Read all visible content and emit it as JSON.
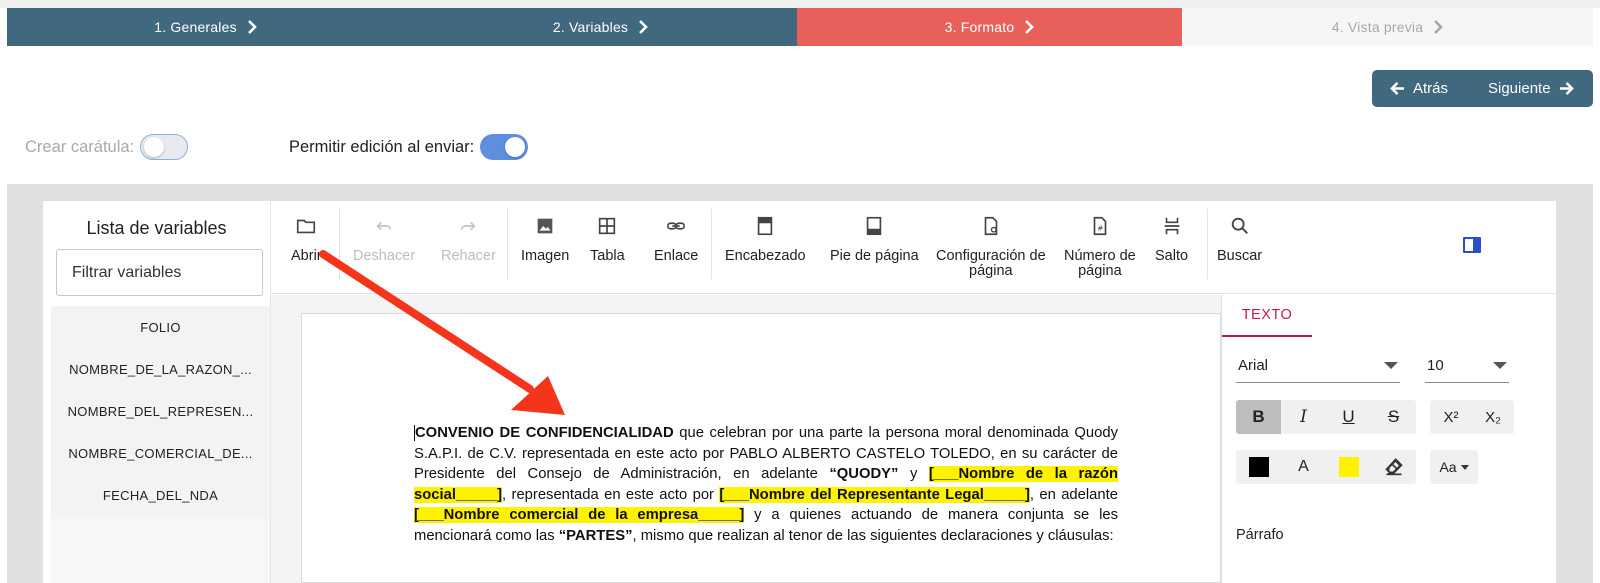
{
  "stepper": {
    "steps": [
      {
        "label": "1. Generales"
      },
      {
        "label": "2. Variables"
      },
      {
        "label": "3. Formato"
      },
      {
        "label": "4. Vista previa"
      }
    ]
  },
  "nav": {
    "back_label": "Atrás",
    "next_label": "Siguiente"
  },
  "toggles": {
    "cover_label": "Crear carátula:",
    "cover_on": false,
    "edit_label": "Permitir edición al enviar:",
    "edit_on": true
  },
  "variables": {
    "title": "Lista de variables",
    "filter_placeholder": "Filtrar variables",
    "items": [
      "FOLIO",
      "NOMBRE_DE_LA_RAZON_...",
      "NOMBRE_DEL_REPRESEN...",
      "NOMBRE_COMERCIAL_DE...",
      "FECHA_DEL_NDA"
    ]
  },
  "toolbar": {
    "open": "Abrir",
    "undo": "Deshacer",
    "redo": "Rehacer",
    "image": "Imagen",
    "table": "Tabla",
    "link": "Enlace",
    "header": "Encabezado",
    "footer": "Pie de página",
    "page_setup_1": "Configuración de",
    "page_setup_2": "página",
    "page_number_1": "Número de",
    "page_number_2": "página",
    "break": "Salto",
    "search": "Buscar"
  },
  "document": {
    "title": "CONVENIO DE CONFIDENCIALIDAD",
    "p1": " que  celebran por una parte la persona moral denominada Quody S.A.P.I. de C.V.  representada en este acto por PABLO ALBERTO CASTELO TOLEDO, en su carácter de Presidente del Consejo de Administración, en adelante ",
    "quody": "“QUODY”",
    "p2": " y ",
    "var1": "[___Nombre de la razón social_____]",
    "p3": ", representada en este acto por ",
    "var2": "[___Nombre del Representante Legal_____]",
    "p4": ", en adelante  ",
    "var3": "[___Nombre comercial de la empresa_____]",
    "p5": " y a quienes actuando de manera conjunta se les mencionará como las ",
    "partes": "“PARTES”",
    "p6": ", mismo que realizan al tenor de las siguientes declaraciones y cláusulas:"
  },
  "format": {
    "tab": "TEXTO",
    "font": "Arial",
    "size": "10",
    "bold": "B",
    "italic": "I",
    "underline": "U",
    "strike": "S",
    "superscript": "X²",
    "subscript": "X₂",
    "font_color_letter": "A",
    "case_label": "Aa",
    "paragraph_label": "Párrafo"
  },
  "colors": {
    "step_done": "#40697f",
    "step_active": "#e9605a",
    "highlight": "#fff200",
    "accent_tab": "#c2185b",
    "arrow": "#f4341b"
  }
}
